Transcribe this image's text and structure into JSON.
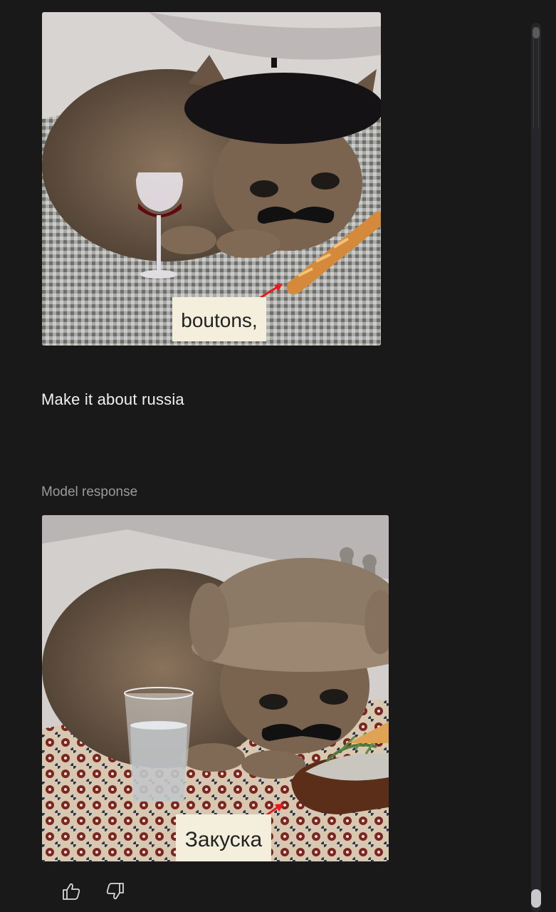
{
  "user_turn": {
    "image": {
      "caption_text": "boutons,"
    },
    "prompt": "Make it about russia"
  },
  "model_turn": {
    "label": "Model response",
    "image": {
      "caption_text": "Закуска"
    }
  },
  "feedback": {
    "thumbs_up_icon": "thumbs-up-icon",
    "thumbs_down_icon": "thumbs-down-icon"
  },
  "colors": {
    "background": "#19191a",
    "text_primary": "#f1f1f1",
    "text_secondary": "#9a9a9a",
    "scroll_thumb": "#c9c9cc"
  }
}
